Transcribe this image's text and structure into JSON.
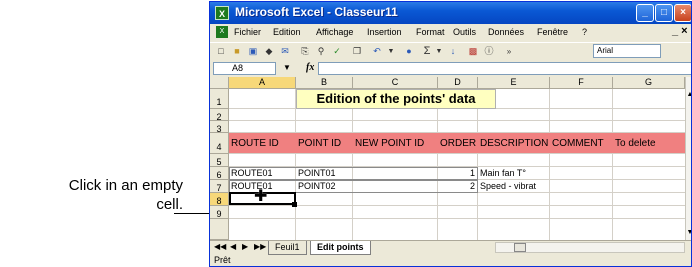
{
  "callout": {
    "line1": "Click in an empty",
    "line2": "cell."
  },
  "window": {
    "title": "Microsoft Excel - Classeur11",
    "app_icon": "X",
    "controls": {
      "minimize": "_",
      "maximize": "□",
      "close": "×"
    }
  },
  "menu": {
    "items": [
      "Fichier",
      "Edition",
      "Affichage",
      "Insertion",
      "Format",
      "Outils",
      "Données",
      "Fenêtre",
      "?"
    ],
    "right_controls": "_ ×"
  },
  "toolbar": {
    "icons": [
      "new-icon",
      "open-icon",
      "save-icon",
      "permission-icon",
      "mail-icon",
      "print-icon",
      "print-preview-icon",
      "spelling-icon",
      "copy-icon",
      "undo-icon",
      "hyperlink-icon",
      "autosum-icon",
      "sort-ascending-icon",
      "chart-icon",
      "help-icon",
      "more-icon"
    ],
    "font_name": "Arial"
  },
  "formula_bar": {
    "name_box": "A8",
    "fx_label": "fx",
    "content": ""
  },
  "sheet": {
    "columns": [
      "A",
      "B",
      "C",
      "D",
      "E",
      "F",
      "G"
    ],
    "rows": [
      "1",
      "2",
      "3",
      "4",
      "5",
      "6",
      "7",
      "8",
      "9"
    ],
    "selected_cell": "A8",
    "title": "Edition of the points' data",
    "header_cells": [
      "ROUTE ID",
      "POINT ID",
      "NEW POINT ID",
      "ORDER",
      "DESCRIPTION",
      "COMMENT",
      "To delete"
    ],
    "data_rows": [
      {
        "route_id": "ROUTE01",
        "point_id": "POINT01",
        "new_point_id": "",
        "order": "1",
        "description": "Main fan T°"
      },
      {
        "route_id": "ROUTE01",
        "point_id": "POINT02",
        "new_point_id": "",
        "order": "2",
        "description": "Speed - vibrat"
      }
    ],
    "colors": {
      "header_fill": "#f08080",
      "title_fill": "#ffffc0",
      "selection_header": "#f7d879"
    }
  },
  "tabs": {
    "items": [
      "Feuil1",
      "Edit points"
    ],
    "active": "Edit points"
  },
  "status": {
    "text": "Prêt"
  }
}
